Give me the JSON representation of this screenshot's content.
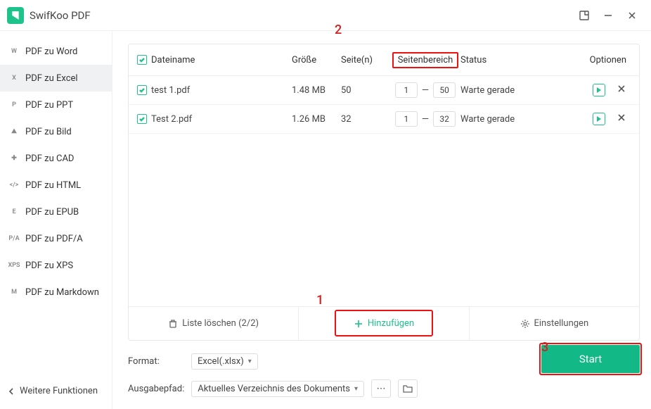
{
  "app": {
    "title": "SwifKoo PDF"
  },
  "titlebar": {},
  "sidebar": {
    "items": [
      {
        "icon": "W",
        "label": "PDF zu Word"
      },
      {
        "icon": "X",
        "label": "PDF zu Excel"
      },
      {
        "icon": "P",
        "label": "PDF zu PPT"
      },
      {
        "icon": "⛰",
        "label": "PDF zu Bild"
      },
      {
        "icon": "✚",
        "label": "PDF zu CAD"
      },
      {
        "icon": "</>",
        "label": "PDF zu HTML"
      },
      {
        "icon": "E",
        "label": "PDF zu EPUB"
      },
      {
        "icon": "P/A",
        "label": "PDF zu PDF/A"
      },
      {
        "icon": "XPS",
        "label": "PDF zu XPS"
      },
      {
        "icon": "M",
        "label": "PDF zu Markdown"
      }
    ],
    "more": "Weitere Funktionen"
  },
  "table": {
    "headers": {
      "name": "Dateiname",
      "size": "Größe",
      "pages": "Seite(n)",
      "range": "Seitenbereich",
      "status": "Status",
      "options": "Optionen"
    },
    "rows": [
      {
        "name": "test 1.pdf",
        "size": "1.48 MB",
        "pages": "50",
        "from": "1",
        "to": "50",
        "status": "Warte gerade"
      },
      {
        "name": "Test 2.pdf",
        "size": "1.26 MB",
        "pages": "32",
        "from": "1",
        "to": "32",
        "status": "Warte gerade"
      }
    ]
  },
  "actions": {
    "clear": "Liste löschen (2/2)",
    "add": "Hinzufügen",
    "settings": "Einstellungen"
  },
  "footer": {
    "format_label": "Format:",
    "format_value": "Excel(.xlsx)",
    "output_label": "Ausgabepfad:",
    "output_value": "Aktuelles Verzeichnis des Dokuments",
    "start": "Start"
  },
  "annotations": {
    "n1": "1",
    "n2": "2",
    "n3": "3"
  }
}
